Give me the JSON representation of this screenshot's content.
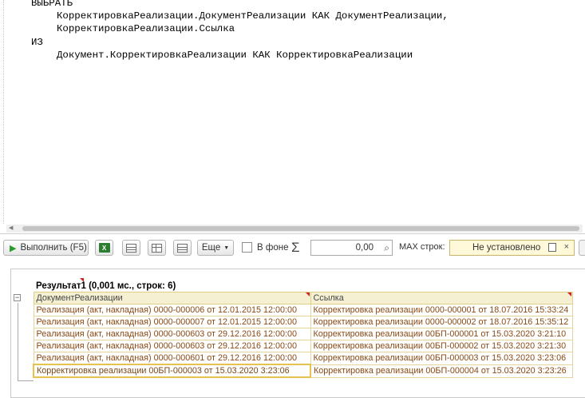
{
  "editor": {
    "lines": [
      "ВЫБРАТЬ",
      "КорректировкаРеализации.ДокументРеализации КАК ДокументРеализации,",
      "КорректировкаРеализации.Ссылка",
      "ИЗ",
      "Документ.КорректировкаРеализации КАК КорректировкаРеализации"
    ]
  },
  "toolbar": {
    "run_label": "Выполнить (F5)",
    "more_label": "Еще",
    "background_label": "В фоне",
    "sum_value": "0,00",
    "max_rows_label": "MAX строк:",
    "max_rows_value": "Не установлено"
  },
  "results": {
    "title": "Результат1 (0,001 мс., строк: 6)",
    "columns": [
      "ДокументРеализации",
      "Ссылка"
    ],
    "rows": [
      [
        "Реализация (акт, накладная) 0000-000006 от 12.01.2015 12:00:00",
        "Корректировка реализации 0000-000001 от 18.07.2016 15:33:24"
      ],
      [
        "Реализация (акт, накладная) 0000-000007 от 12.01.2015 12:00:00",
        "Корректировка реализации 0000-000002 от 18.07.2016 15:35:12"
      ],
      [
        "Реализация (акт, накладная) 0000-000603 от 29.12.2016 12:00:00",
        "Корректировка реализации 00БП-000001 от 15.03.2020 3:21:10"
      ],
      [
        "Реализация (акт, накладная) 0000-000603 от 29.12.2016 12:00:00",
        "Корректировка реализации 00БП-000002 от 15.03.2020 3:21:30"
      ],
      [
        "Реализация (акт, накладная) 0000-000601 от 29.12.2016 12:00:00",
        "Корректировка реализации 00БП-000003 от 15.03.2020 3:23:06"
      ],
      [
        "Корректировка реализации 00БП-000003 от 15.03.2020 3:23:06",
        "Корректировка реализации 00БП-000004 от 15.03.2020 3:23:26"
      ]
    ]
  }
}
